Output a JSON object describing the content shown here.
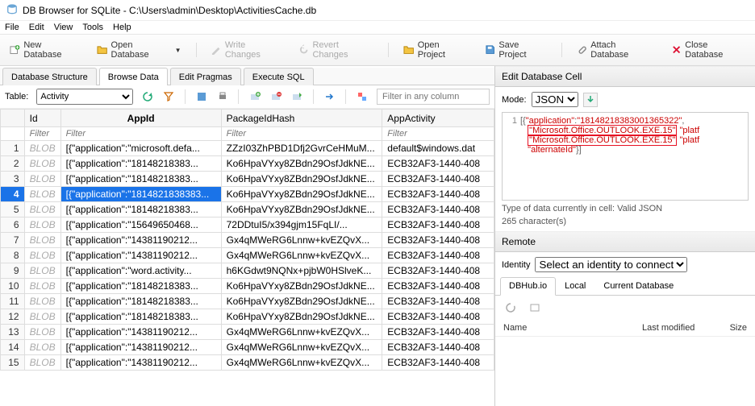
{
  "title": "DB Browser for SQLite - C:\\Users\\admin\\Desktop\\ActivitiesCache.db",
  "menu": [
    "File",
    "Edit",
    "View",
    "Tools",
    "Help"
  ],
  "toolbar": {
    "new_db": "New Database",
    "open_db": "Open Database",
    "write": "Write Changes",
    "revert": "Revert Changes",
    "open_proj": "Open Project",
    "save_proj": "Save Project",
    "attach": "Attach Database",
    "close": "Close Database"
  },
  "tabs": [
    "Database Structure",
    "Browse Data",
    "Edit Pragmas",
    "Execute SQL"
  ],
  "active_tab": "Browse Data",
  "table_label": "Table:",
  "table_name": "Activity",
  "filter_placeholder": "Filter in any column",
  "col_filter": "Filter",
  "columns": [
    "Id",
    "AppId",
    "PackageIdHash",
    "AppActivity"
  ],
  "selected_row": 4,
  "rows": [
    {
      "n": 1,
      "id": "BLOB",
      "appid": "[{\"application\":\"microsoft.defa...",
      "pkg": "ZZzI03ZhPBD1Dfj2GvrCeHMuM...",
      "act": "default$windows.dat"
    },
    {
      "n": 2,
      "id": "BLOB",
      "appid": "[{\"application\":\"18148218383...",
      "pkg": "Ko6HpaVYxy8ZBdn29OsfJdkNE...",
      "act": "ECB32AF3-1440-408"
    },
    {
      "n": 3,
      "id": "BLOB",
      "appid": "[{\"application\":\"18148218383...",
      "pkg": "Ko6HpaVYxy8ZBdn29OsfJdkNE...",
      "act": "ECB32AF3-1440-408"
    },
    {
      "n": 4,
      "id": "BLOB",
      "appid": "[{\"application\":\"1814821838383...",
      "pkg": "Ko6HpaVYxy8ZBdn29OsfJdkNE...",
      "act": "ECB32AF3-1440-408"
    },
    {
      "n": 5,
      "id": "BLOB",
      "appid": "[{\"application\":\"18148218383...",
      "pkg": "Ko6HpaVYxy8ZBdn29OsfJdkNE...",
      "act": "ECB32AF3-1440-408"
    },
    {
      "n": 6,
      "id": "BLOB",
      "appid": "[{\"application\":\"15649650468...",
      "pkg": "72DDtuI5/x394gjm15FqLI/...",
      "act": "ECB32AF3-1440-408"
    },
    {
      "n": 7,
      "id": "BLOB",
      "appid": "[{\"application\":\"14381190212...",
      "pkg": "Gx4qMWeRG6Lnnw+kvEZQvX...",
      "act": "ECB32AF3-1440-408"
    },
    {
      "n": 8,
      "id": "BLOB",
      "appid": "[{\"application\":\"14381190212...",
      "pkg": "Gx4qMWeRG6Lnnw+kvEZQvX...",
      "act": "ECB32AF3-1440-408"
    },
    {
      "n": 9,
      "id": "BLOB",
      "appid": "[{\"application\":\"word.activity...",
      "pkg": "h6KGdwt9NQNx+pjbW0HSlveK...",
      "act": "ECB32AF3-1440-408"
    },
    {
      "n": 10,
      "id": "BLOB",
      "appid": "[{\"application\":\"18148218383...",
      "pkg": "Ko6HpaVYxy8ZBdn29OsfJdkNE...",
      "act": "ECB32AF3-1440-408"
    },
    {
      "n": 11,
      "id": "BLOB",
      "appid": "[{\"application\":\"18148218383...",
      "pkg": "Ko6HpaVYxy8ZBdn29OsfJdkNE...",
      "act": "ECB32AF3-1440-408"
    },
    {
      "n": 12,
      "id": "BLOB",
      "appid": "[{\"application\":\"18148218383...",
      "pkg": "Ko6HpaVYxy8ZBdn29OsfJdkNE...",
      "act": "ECB32AF3-1440-408"
    },
    {
      "n": 13,
      "id": "BLOB",
      "appid": "[{\"application\":\"14381190212...",
      "pkg": "Gx4qMWeRG6Lnnw+kvEZQvX...",
      "act": "ECB32AF3-1440-408"
    },
    {
      "n": 14,
      "id": "BLOB",
      "appid": "[{\"application\":\"14381190212...",
      "pkg": "Gx4qMWeRG6Lnnw+kvEZQvX...",
      "act": "ECB32AF3-1440-408"
    },
    {
      "n": 15,
      "id": "BLOB",
      "appid": "[{\"application\":\"14381190212...",
      "pkg": "Gx4qMWeRG6Lnnw+kvEZQvX...",
      "act": "ECB32AF3-1440-408"
    }
  ],
  "edit_cell": {
    "title": "Edit Database Cell",
    "mode_label": "Mode:",
    "mode": "JSON",
    "json_line": "1",
    "json_prefix": "[{",
    "json_app_key": "\"application\"",
    "json_app_val": "\"18148218383001365322\"",
    "hl1": "\"Microsoft.Office.OUTLOOK.EXE.15\"",
    "plat1": "\"platf",
    "hl2": "\"Microsoft.Office.OUTLOOK.EXE.15\"",
    "plat2": "\"platf",
    "alt_key": "\"alternateId\"",
    "json_suffix": "}]",
    "type_label": "Type of data currently in cell: Valid JSON",
    "char_label": "265 character(s)"
  },
  "remote": {
    "title": "Remote",
    "identity_label": "Identity",
    "identity_val": "Select an identity to connect",
    "tabs": [
      "DBHub.io",
      "Local",
      "Current Database"
    ],
    "cols": {
      "name": "Name",
      "lm": "Last modified",
      "size": "Size"
    }
  }
}
